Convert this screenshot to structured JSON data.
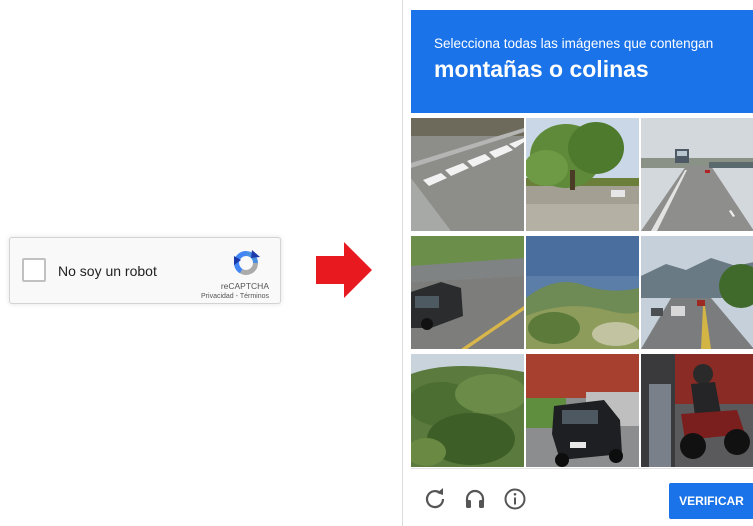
{
  "widget": {
    "label": "No soy un robot",
    "checked": false,
    "brand": "reCAPTCHA",
    "privacy": "Privacidad",
    "separator": " - ",
    "terms": "Términos"
  },
  "challenge": {
    "instruction": "Selecciona todas las imágenes que contengan",
    "target": "montañas o colinas",
    "tiles": [
      {
        "id": 1,
        "content": "crosswalk-road"
      },
      {
        "id": 2,
        "content": "trees-parking"
      },
      {
        "id": 3,
        "content": "highway-bus"
      },
      {
        "id": 4,
        "content": "car-road"
      },
      {
        "id": 5,
        "content": "hills"
      },
      {
        "id": 6,
        "content": "mountains-road"
      },
      {
        "id": 7,
        "content": "forest-hill"
      },
      {
        "id": 8,
        "content": "suv-street"
      },
      {
        "id": 9,
        "content": "motorcycle"
      }
    ],
    "footer": {
      "reload_icon": "reload-icon",
      "audio_icon": "headphones-icon",
      "info_icon": "info-icon",
      "verify_label": "VERIFICAR"
    }
  },
  "colors": {
    "header_blue": "#1a73e8",
    "arrow_red": "#e8191f",
    "widget_bg": "#f9f9f9"
  }
}
